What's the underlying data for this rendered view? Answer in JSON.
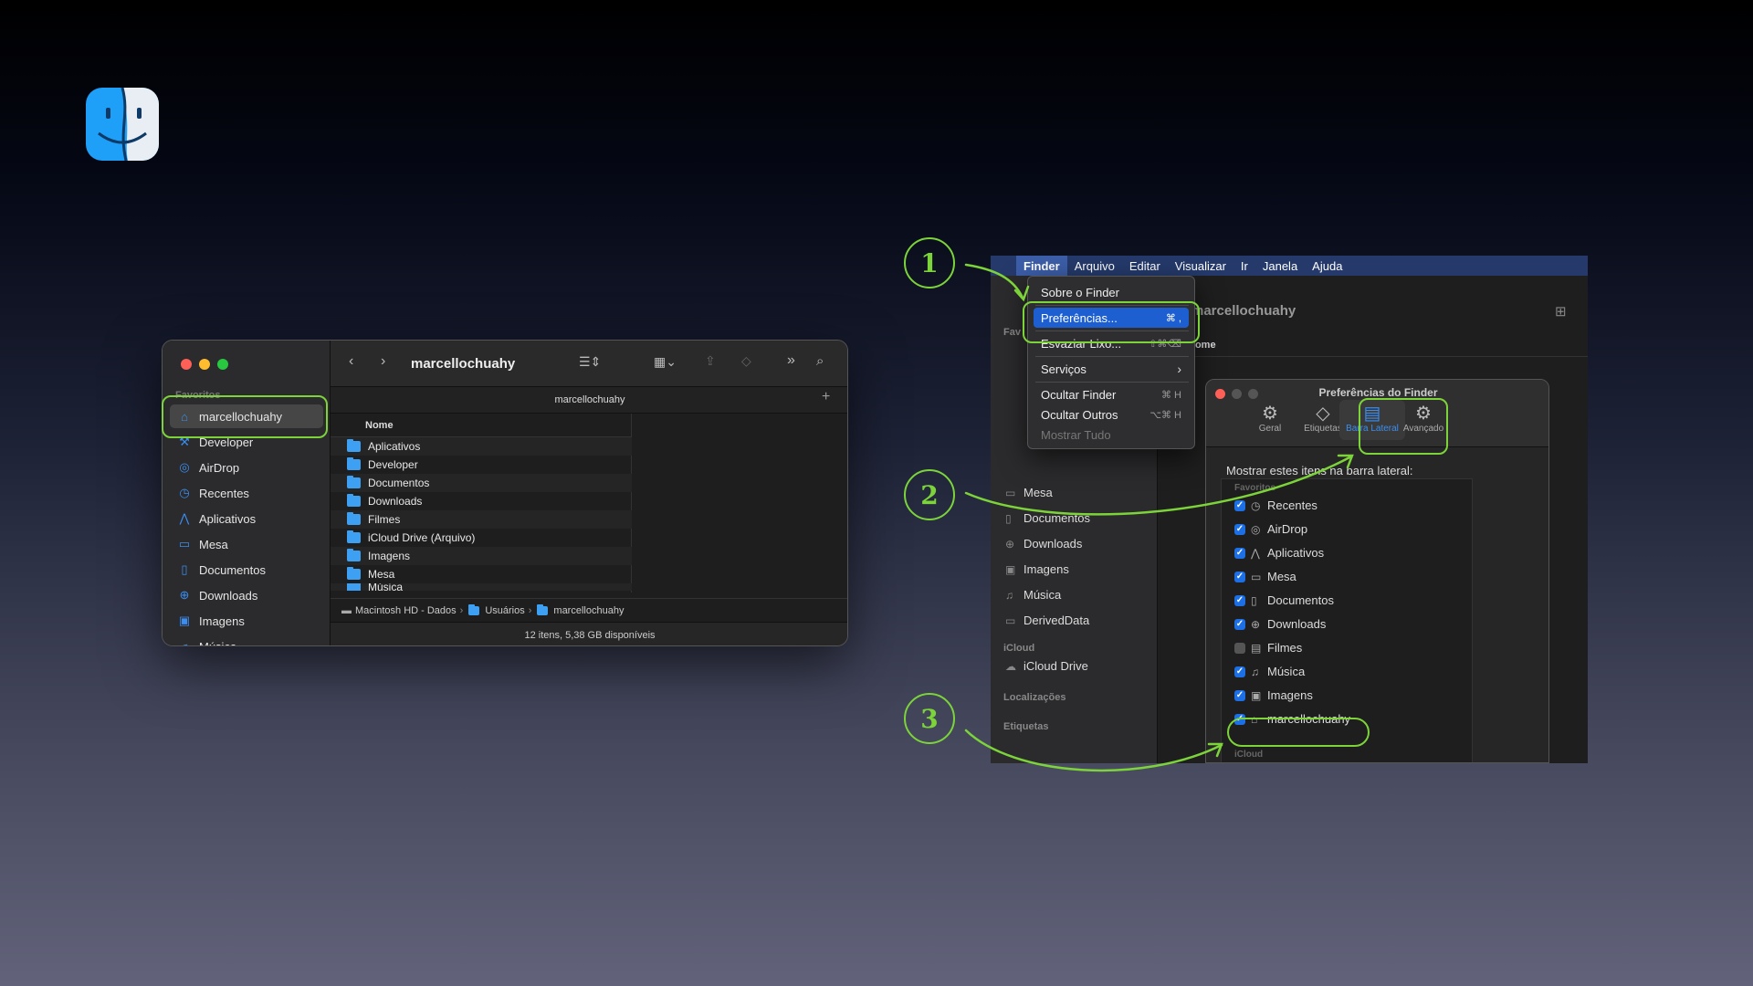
{
  "left_window": {
    "title": "marcellochuahy",
    "tab": "marcellochuahy",
    "sidebar_section": "Favoritos",
    "sidebar_items": [
      {
        "label": "marcellochuahy",
        "icon": "home-icon"
      },
      {
        "label": "Developer",
        "icon": "hammer-icon"
      },
      {
        "label": "AirDrop",
        "icon": "airdrop-icon"
      },
      {
        "label": "Recentes",
        "icon": "clock-icon"
      },
      {
        "label": "Aplicativos",
        "icon": "apps-icon"
      },
      {
        "label": "Mesa",
        "icon": "desktop-icon"
      },
      {
        "label": "Documentos",
        "icon": "document-icon"
      },
      {
        "label": "Downloads",
        "icon": "download-icon"
      },
      {
        "label": "Imagens",
        "icon": "photo-icon"
      },
      {
        "label": "Música",
        "icon": "music-icon"
      }
    ],
    "column_header": "Nome",
    "files": [
      "Aplicativos",
      "Developer",
      "Documentos",
      "Downloads",
      "Filmes",
      "iCloud Drive (Arquivo)",
      "Imagens",
      "Mesa",
      "Música"
    ],
    "path": [
      "Macintosh HD - Dados",
      "Usuários",
      "marcellochuahy"
    ],
    "status": "12 itens, 5,38 GB disponíveis"
  },
  "steps": [
    "1",
    "2",
    "3"
  ],
  "right": {
    "menubar": [
      "Finder",
      "Arquivo",
      "Editar",
      "Visualizar",
      "Ir",
      "Janela",
      "Ajuda"
    ],
    "window_title": "marcellochuahy",
    "column_header": "Nome",
    "menu": {
      "about": "Sobre o Finder",
      "prefs": "Preferências...",
      "prefs_sc": "⌘ ,",
      "empty": "Esvaziar Lixo...",
      "empty_sc": "⇧⌘⌫",
      "services": "Serviços",
      "hide": "Ocultar Finder",
      "hide_sc": "⌘ H",
      "hide_others": "Ocultar Outros",
      "hide_others_sc": "⌥⌘ H",
      "show_all": "Mostrar Tudo"
    },
    "sidebar": {
      "fav_label": "Fav",
      "items": [
        "Mesa",
        "Documentos",
        "Downloads",
        "Imagens",
        "Música",
        "DerivedData"
      ],
      "icloud_label": "iCloud",
      "icloud_item": "iCloud Drive",
      "locations_label": "Localizações",
      "tags_label": "Etiquetas"
    },
    "prefs": {
      "title": "Preferências do Finder",
      "tabs": [
        "Geral",
        "Etiquetas",
        "Barra Lateral",
        "Avançado"
      ],
      "heading": "Mostrar estes itens na barra lateral:",
      "fav_label": "Favoritos",
      "items": [
        {
          "label": "Recentes",
          "checked": true
        },
        {
          "label": "AirDrop",
          "checked": true
        },
        {
          "label": "Aplicativos",
          "checked": true
        },
        {
          "label": "Mesa",
          "checked": true
        },
        {
          "label": "Documentos",
          "checked": true
        },
        {
          "label": "Downloads",
          "checked": true
        },
        {
          "label": "Filmes",
          "checked": false
        },
        {
          "label": "Música",
          "checked": true
        },
        {
          "label": "Imagens",
          "checked": true
        },
        {
          "label": "marcellochuahy",
          "checked": true
        }
      ],
      "icloud_label": "iCloud"
    }
  },
  "colors": {
    "highlight": "#7cd33a",
    "accent": "#1d5fd1",
    "folder": "#3da0f2"
  }
}
